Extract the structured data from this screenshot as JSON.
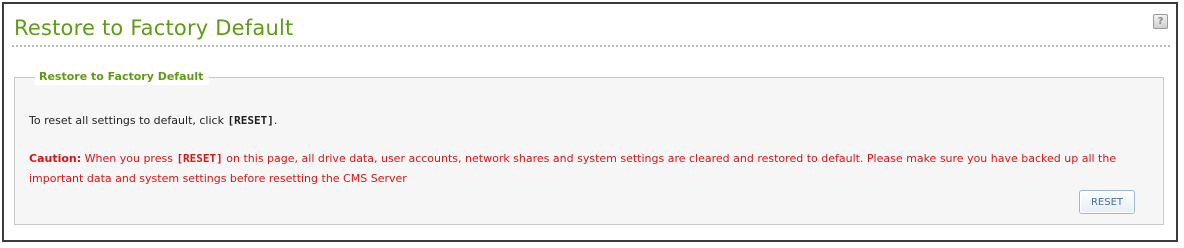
{
  "header": {
    "title": "Restore to Factory Default",
    "help_icon": "help-icon"
  },
  "panel": {
    "legend": "Restore to Factory Default",
    "instruction_prefix": "To reset all settings to default, click ",
    "instruction_keyword": "[RESET]",
    "instruction_suffix": ".",
    "caution_label": "Caution:",
    "caution_pre": " When you press ",
    "caution_keyword": "[RESET]",
    "caution_post": " on this page, all drive data, user accounts, network shares and system settings are cleared and restored to default. Please make sure you have backed up all the important data and system settings before resetting the CMS  Server",
    "reset_button_label": "RESET"
  },
  "colors": {
    "title_green": "#5e9c14",
    "caution_red": "#d11818",
    "button_text_blue": "#3f6fa3"
  }
}
